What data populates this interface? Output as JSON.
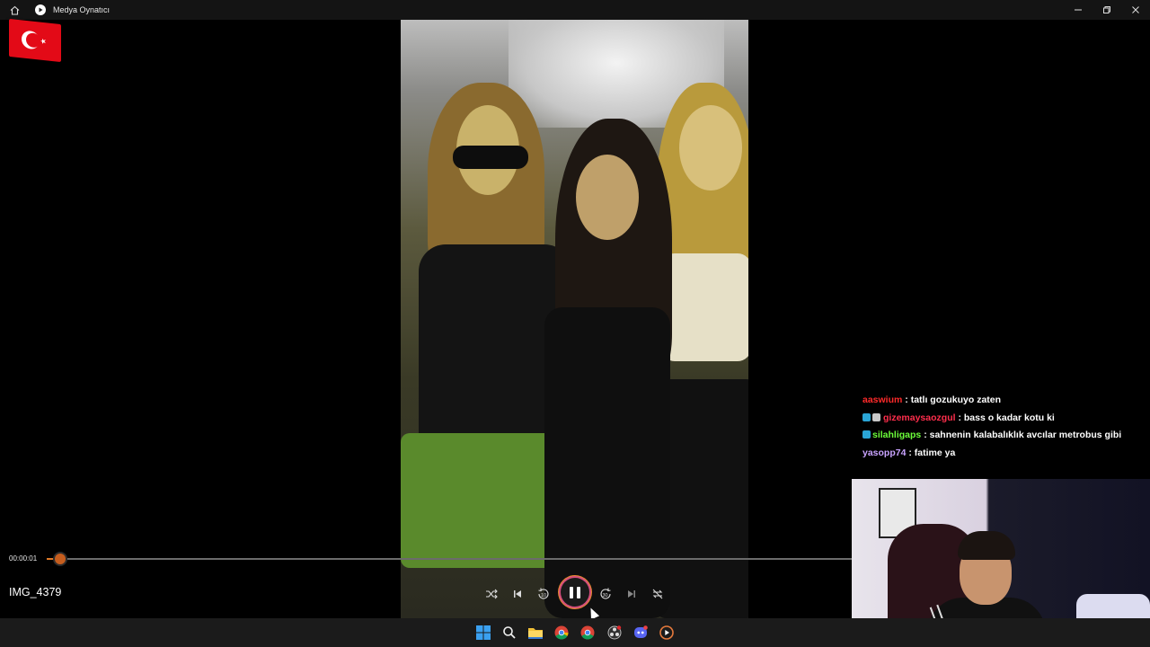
{
  "window": {
    "title": "Medya Oynatıcı"
  },
  "player": {
    "current_time": "00:00:01",
    "file_name": "IMG_4379",
    "progress_fraction": 0.017
  },
  "chat": [
    {
      "user": "aaswium",
      "user_color": "#ff2a2a",
      "message": "tatlı gozukuyo zaten",
      "badges": 0
    },
    {
      "user": "gizemaysaozgul",
      "user_color": "#ff2e4c",
      "message": "bass o kadar kotu ki",
      "badges": 2
    },
    {
      "user": "silahligaps",
      "user_color": "#6cff3a",
      "message": "sahnenin kalabalıklık avcılar metrobus gibi",
      "badges": 1
    },
    {
      "user": "yasopp74",
      "user_color": "#c9a3ff",
      "message": "fatime ya",
      "badges": 0
    }
  ],
  "taskbar": {
    "items": [
      {
        "name": "windows-start-icon"
      },
      {
        "name": "search-icon"
      },
      {
        "name": "file-explorer-icon"
      },
      {
        "name": "chrome-icon"
      },
      {
        "name": "chrome-profile-icon"
      },
      {
        "name": "obs-icon"
      },
      {
        "name": "discord-icon"
      },
      {
        "name": "media-player-icon"
      }
    ]
  },
  "colors": {
    "seek_accent": "#e07a28",
    "play_ring": "#d44e7c",
    "taskbar_bg": "#1b1b1b"
  }
}
